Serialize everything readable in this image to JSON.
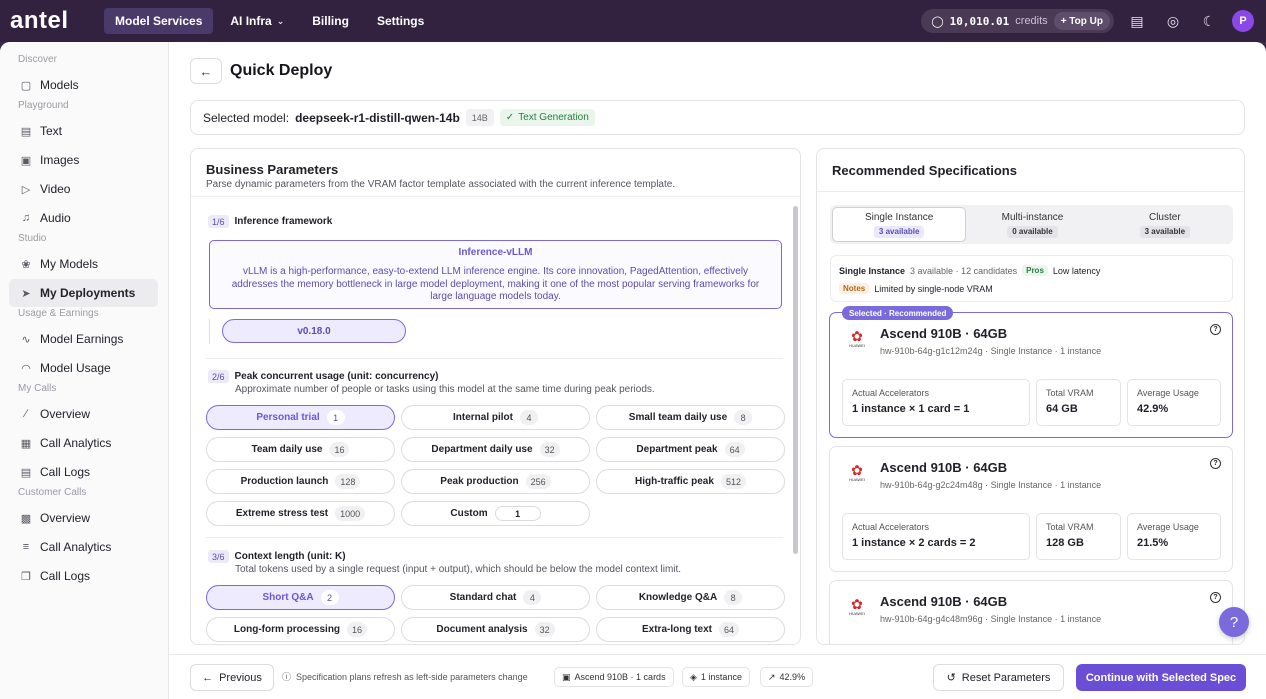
{
  "app": {
    "logo": "antel",
    "nav": [
      {
        "label": "Model Services",
        "active": true
      },
      {
        "label": "AI Infra",
        "has_dropdown": true
      },
      {
        "label": "Billing"
      },
      {
        "label": "Settings"
      }
    ],
    "credits": {
      "amount": "10,010.01",
      "label": "credits",
      "topup_label": "+ Top Up"
    },
    "avatar_initial": "P"
  },
  "sidebar": {
    "groups": [
      {
        "label": "Discover",
        "items": [
          {
            "label": "Models",
            "icon": "cube-icon"
          }
        ]
      },
      {
        "label": "Playground",
        "items": [
          {
            "label": "Text",
            "icon": "message-icon"
          },
          {
            "label": "Images",
            "icon": "image-icon"
          },
          {
            "label": "Video",
            "icon": "video-icon"
          },
          {
            "label": "Audio",
            "icon": "audio-icon"
          }
        ]
      },
      {
        "label": "Studio",
        "items": [
          {
            "label": "My Models",
            "icon": "brain-icon"
          },
          {
            "label": "My Deployments",
            "icon": "rocket-icon",
            "active": true
          }
        ]
      },
      {
        "label": "Usage & Earnings",
        "items": [
          {
            "label": "Model Earnings",
            "icon": "pulse-icon"
          },
          {
            "label": "Model Usage",
            "icon": "gauge-icon"
          }
        ]
      },
      {
        "label": "My Calls",
        "items": [
          {
            "label": "Overview",
            "icon": "line-chart-icon"
          },
          {
            "label": "Call Analytics",
            "icon": "table-icon"
          },
          {
            "label": "Call Logs",
            "icon": "log-icon"
          }
        ]
      },
      {
        "label": "Customer Calls",
        "items": [
          {
            "label": "Overview",
            "icon": "bar-chart-icon"
          },
          {
            "label": "Call Analytics",
            "icon": "list-icon"
          },
          {
            "label": "Call Logs",
            "icon": "copy-icon"
          }
        ]
      }
    ]
  },
  "page": {
    "title": "Quick Deploy",
    "selected_model_label": "Selected model:",
    "model_name": "deepseek-r1-distill-qwen-14b",
    "model_size": "14B",
    "model_task": "Text Generation"
  },
  "business": {
    "title": "Business Parameters",
    "subtitle": "Parse dynamic parameters from the VRAM factor template associated with the current inference template.",
    "framework": {
      "step": "1/6",
      "title": "Inference framework",
      "name": "Inference-vLLM",
      "description": "vLLM is a high-performance, easy-to-extend LLM inference engine. Its core innovation, PagedAttention, effectively addresses the memory bottleneck in large model deployment, making it one of the most popular serving frameworks for large language models today.",
      "version": "v0.18.0"
    },
    "concurrency": {
      "step": "2/6",
      "title": "Peak concurrent usage (unit: concurrency)",
      "subtitle": "Approximate number of people or tasks using this model at the same time during peak periods.",
      "options": [
        {
          "label": "Personal trial",
          "value": "1",
          "selected": true
        },
        {
          "label": "Internal pilot",
          "value": "4"
        },
        {
          "label": "Small team daily use",
          "value": "8"
        },
        {
          "label": "Team daily use",
          "value": "16"
        },
        {
          "label": "Department daily use",
          "value": "32"
        },
        {
          "label": "Department peak",
          "value": "64"
        },
        {
          "label": "Production launch",
          "value": "128"
        },
        {
          "label": "Peak production",
          "value": "256"
        },
        {
          "label": "High-traffic peak",
          "value": "512"
        },
        {
          "label": "Extreme stress test",
          "value": "1000"
        }
      ],
      "custom": {
        "label": "Custom",
        "value": "1"
      }
    },
    "context": {
      "step": "3/6",
      "title": "Context length (unit: K)",
      "subtitle": "Total tokens used by a single request (input + output), which should be below the model context limit.",
      "options": [
        {
          "label": "Short Q&A",
          "value": "2",
          "selected": true
        },
        {
          "label": "Standard chat",
          "value": "4"
        },
        {
          "label": "Knowledge Q&A",
          "value": "8"
        },
        {
          "label": "Long-form processing",
          "value": "16"
        },
        {
          "label": "Document analysis",
          "value": "32"
        },
        {
          "label": "Extra-long text",
          "value": "64"
        }
      ]
    }
  },
  "specs": {
    "title": "Recommended Specifications",
    "tabs": [
      {
        "label": "Single Instance",
        "badge": "3 available",
        "active": true
      },
      {
        "label": "Multi-instance",
        "badge": "0 available"
      },
      {
        "label": "Cluster",
        "badge": "3 available"
      }
    ],
    "info": {
      "name": "Single Instance",
      "summary": "3 available · 12 candidates",
      "pros_tag": "Pros",
      "pros": "Low latency",
      "notes_tag": "Notes",
      "notes": "Limited by single-node VRAM"
    },
    "selected_tag": "Selected · Recommended",
    "brand_logo_text": "HUAWEI",
    "metric_labels": {
      "accelerators": "Actual Accelerators",
      "vram": "Total VRAM",
      "usage": "Average Usage"
    },
    "cards": [
      {
        "title": "Ascend 910B · 64GB",
        "subtitle": "hw-910b-64g-g1c12m24g · Single Instance · 1 instance",
        "accelerators": "1 instance × 1 card = 1",
        "vram": "64 GB",
        "usage": "42.9%",
        "selected": true
      },
      {
        "title": "Ascend 910B · 64GB",
        "subtitle": "hw-910b-64g-g2c24m48g · Single Instance · 1 instance",
        "accelerators": "1 instance × 2 cards = 2",
        "vram": "128 GB",
        "usage": "21.5%"
      },
      {
        "title": "Ascend 910B · 64GB",
        "subtitle": "hw-910b-64g-g4c48m96g · Single Instance · 1 instance"
      }
    ]
  },
  "footer": {
    "previous": "Previous",
    "note": "Specification plans refresh as left-side parameters change",
    "chips": [
      {
        "label": "Ascend 910B · 1 cards",
        "icon": "chip-icon"
      },
      {
        "label": "1 instance",
        "icon": "box-icon"
      },
      {
        "label": "42.9%",
        "icon": "trend-icon"
      }
    ],
    "reset": "Reset Parameters",
    "continue": "Continue with Selected Spec"
  }
}
